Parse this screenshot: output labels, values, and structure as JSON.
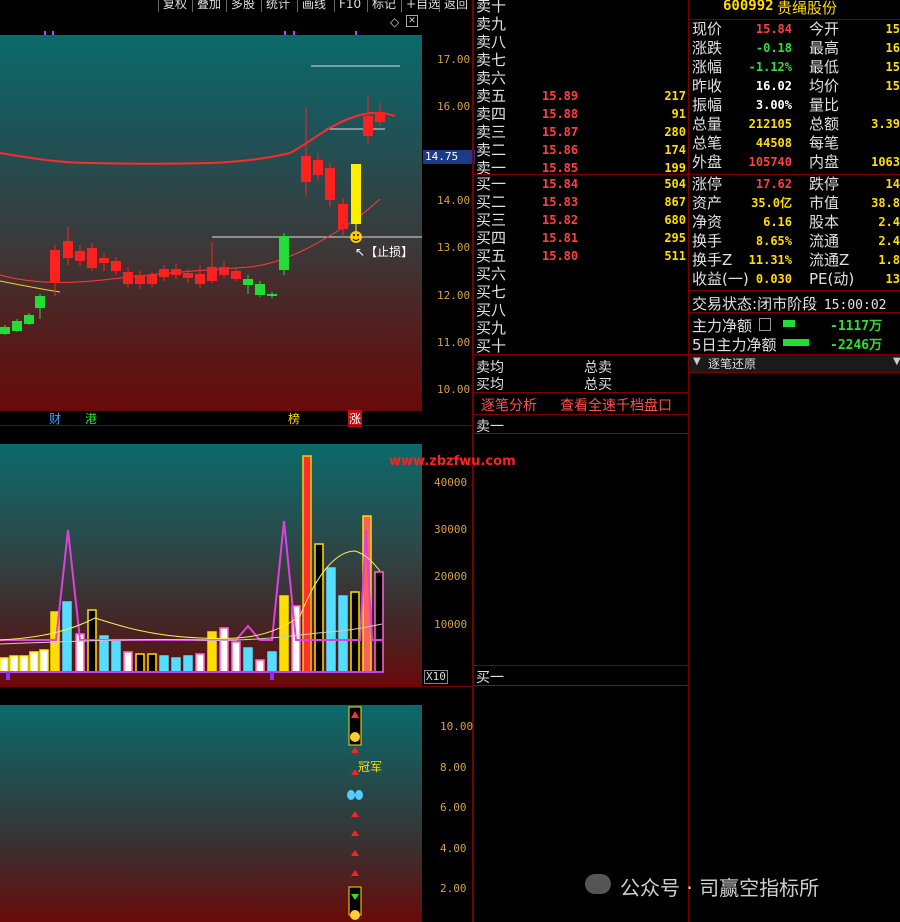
{
  "toolbar": {
    "buttons": [
      "复权",
      "叠加",
      "多股",
      "统计",
      "画线",
      "F10",
      "标记",
      "+自选",
      "返回"
    ]
  },
  "main_chart": {
    "y_ticks": [
      "17.00",
      "16.00",
      "15.00",
      "14.00",
      "13.00",
      "12.00",
      "11.00",
      "10.00"
    ],
    "current_price_tag": "14.75",
    "stop_loss_label": "【止损】",
    "event_markers": [
      "财",
      "港",
      "榜",
      "涨"
    ]
  },
  "volume_chart": {
    "y_ticks": [
      "40000",
      "30000",
      "20000",
      "10000"
    ],
    "scale_label": "X10",
    "watermark": "www.zbzfwu.com"
  },
  "indicator_chart": {
    "y_ticks": [
      "10.00",
      "8.00",
      "6.00",
      "4.00",
      "2.00"
    ],
    "champion_label": "冠军"
  },
  "order_book": {
    "sell": [
      {
        "name": "卖十",
        "price": "",
        "vol": ""
      },
      {
        "name": "卖九",
        "price": "",
        "vol": ""
      },
      {
        "name": "卖八",
        "price": "",
        "vol": ""
      },
      {
        "name": "卖七",
        "price": "",
        "vol": ""
      },
      {
        "name": "卖六",
        "price": "",
        "vol": ""
      },
      {
        "name": "卖五",
        "price": "15.89",
        "vol": "217"
      },
      {
        "name": "卖四",
        "price": "15.88",
        "vol": "91"
      },
      {
        "name": "卖三",
        "price": "15.87",
        "vol": "280"
      },
      {
        "name": "卖二",
        "price": "15.86",
        "vol": "174"
      },
      {
        "name": "卖一",
        "price": "15.85",
        "vol": "199"
      }
    ],
    "buy": [
      {
        "name": "买一",
        "price": "15.84",
        "vol": "504"
      },
      {
        "name": "买二",
        "price": "15.83",
        "vol": "867"
      },
      {
        "name": "买三",
        "price": "15.82",
        "vol": "680"
      },
      {
        "name": "买四",
        "price": "15.81",
        "vol": "295"
      },
      {
        "name": "买五",
        "price": "15.80",
        "vol": "511"
      },
      {
        "name": "买六",
        "price": "",
        "vol": ""
      },
      {
        "name": "买七",
        "price": "",
        "vol": ""
      },
      {
        "name": "买八",
        "price": "",
        "vol": ""
      },
      {
        "name": "买九",
        "price": "",
        "vol": ""
      },
      {
        "name": "买十",
        "price": "",
        "vol": ""
      }
    ],
    "avg_sell": "卖均",
    "avg_buy": "买均",
    "total_sell": "总卖",
    "total_buy": "总买",
    "tab_tick": "逐笔分析",
    "tab_view_all": "查看全速千档盘口",
    "list_top_label": "卖一",
    "list_bottom_label": "买一"
  },
  "stock": {
    "code": "600992",
    "name": "贵绳股份"
  },
  "info": [
    {
      "l": "现价",
      "v": "15.84",
      "vc": "#ff4040",
      "l2": "今开",
      "v2": "15"
    },
    {
      "l": "涨跌",
      "v": "-0.18",
      "vc": "#33dd33",
      "l2": "最高",
      "v2": "16"
    },
    {
      "l": "涨幅",
      "v": "-1.12%",
      "vc": "#33dd33",
      "l2": "最低",
      "v2": "15"
    },
    {
      "l": "昨收",
      "v": "16.02",
      "vc": "#ffffff",
      "l2": "均价",
      "v2": "15"
    },
    {
      "l": "振幅",
      "v": "3.00%",
      "vc": "#ffffff",
      "l2": "量比",
      "v2": ""
    },
    {
      "l": "总量",
      "v": "212105",
      "vc": "#ffdd00",
      "l2": "总额",
      "v2": "3.39"
    },
    {
      "l": "总笔",
      "v": "44508",
      "vc": "#ffdd00",
      "l2": "每笔",
      "v2": ""
    },
    {
      "l": "外盘",
      "v": "105740",
      "vc": "#ff4040",
      "l2": "内盘",
      "v2": "1063"
    }
  ],
  "info2": [
    {
      "l": "涨停",
      "v": "17.62",
      "vc": "#ff4040",
      "l2": "跌停",
      "v2": "14"
    },
    {
      "l": "资产",
      "v": "35.0亿",
      "vc": "#ffdd00",
      "l2": "市值",
      "v2": "38.8"
    },
    {
      "l": "净资",
      "v": "6.16",
      "vc": "#ffdd00",
      "l2": "股本",
      "v2": "2.4"
    },
    {
      "l": "换手",
      "v": "8.65%",
      "vc": "#ffdd00",
      "l2": "流通",
      "v2": "2.4"
    },
    {
      "l": "换手Z",
      "v": "11.31%",
      "vc": "#ffdd00",
      "l2": "流通Z",
      "v2": "1.8"
    },
    {
      "l": "收益(一)",
      "v": "0.030",
      "vc": "#ffdd00",
      "l2": "PE(动)",
      "v2": "13"
    }
  ],
  "trade_state": {
    "label": "交易状态:",
    "value": "闭市阶段",
    "time": "15:00:02"
  },
  "flow": {
    "main_label": "主力净额",
    "main_value": "-1117万",
    "five_label": "5日主力净额",
    "five_value": "-2246万"
  },
  "tick_restore": "逐笔还原",
  "footer": {
    "wechat": "公众号 · 司赢空指标所"
  },
  "colors": {
    "up": "#ff2020",
    "down": "#22dd33",
    "axis": "#d6a046",
    "separator": "#7a0000"
  }
}
